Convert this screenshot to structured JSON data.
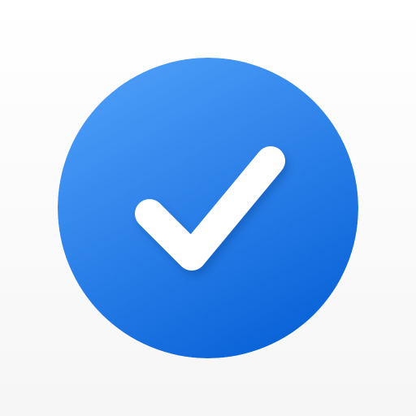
{
  "icon": {
    "name": "checkmark-circle-icon",
    "colors": {
      "circle_top": "#4a9bf7",
      "circle_bottom": "#0a63d8",
      "check": "#ffffff",
      "background": "#f8f8f8"
    }
  }
}
